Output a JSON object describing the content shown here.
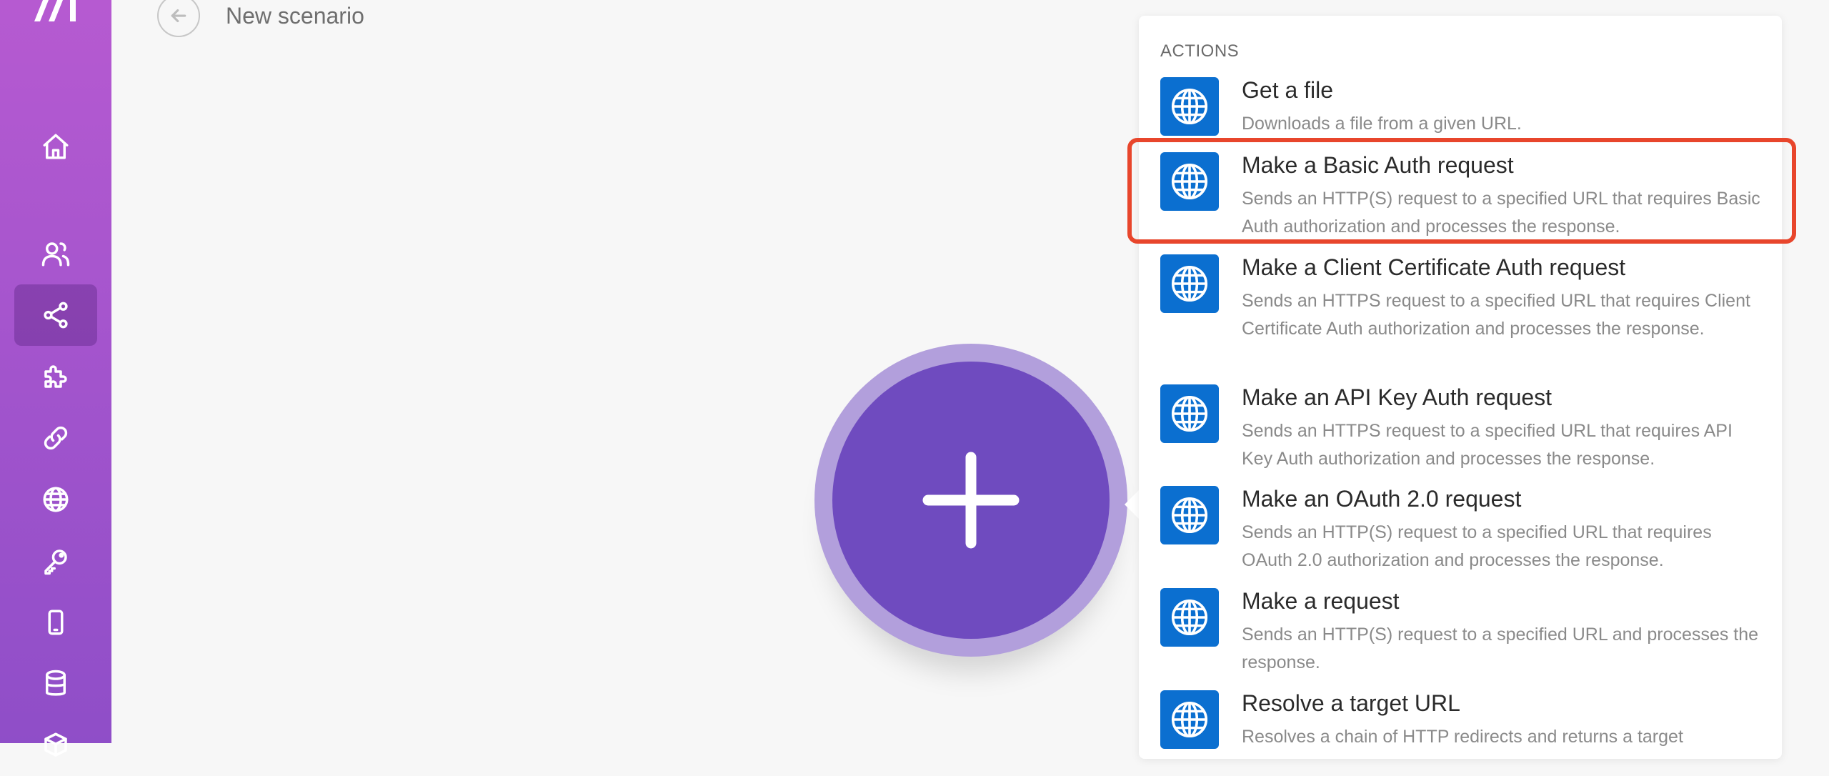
{
  "header": {
    "title": "New scenario"
  },
  "sidebar": {
    "items": [
      {
        "name": "home",
        "icon": "home-icon",
        "active": false
      },
      {
        "name": "team",
        "icon": "users-icon",
        "active": false
      },
      {
        "name": "scenarios",
        "icon": "share-icon",
        "active": true
      },
      {
        "name": "apps",
        "icon": "puzzle-icon",
        "active": false
      },
      {
        "name": "connections",
        "icon": "link-icon",
        "active": false
      },
      {
        "name": "webhooks",
        "icon": "globe-icon",
        "active": false
      },
      {
        "name": "keys",
        "icon": "key-icon",
        "active": false
      },
      {
        "name": "devices",
        "icon": "mobile-icon",
        "active": false
      },
      {
        "name": "data-stores",
        "icon": "database-icon",
        "active": false
      },
      {
        "name": "data-structures",
        "icon": "cube-icon",
        "active": false
      }
    ]
  },
  "panel": {
    "section_label": "ACTIONS",
    "highlighted_index": 1,
    "accent_color": "#e8462c",
    "icon_color": "#0b6fd0",
    "actions": [
      {
        "title": "Get a file",
        "description": "Downloads a file from a given URL."
      },
      {
        "title": "Make a Basic Auth request",
        "description": "Sends an HTTP(S) request to a specified URL that requires Basic Auth authorization and processes the response."
      },
      {
        "title": "Make a Client Certificate Auth request",
        "description": "Sends an HTTPS request to a specified URL that requires Client Certificate Auth authorization and processes the response."
      },
      {
        "title": "Make an API Key Auth request",
        "description": "Sends an HTTPS request to a specified URL that requires API Key Auth authorization and processes the response."
      },
      {
        "title": "Make an OAuth 2.0 request",
        "description": "Sends an HTTP(S) request to a specified URL that requires OAuth 2.0 authorization and processes the response."
      },
      {
        "title": "Make a request",
        "description": "Sends an HTTP(S) request to a specified URL and processes the response."
      },
      {
        "title": "Resolve a target URL",
        "description": "Resolves a chain of HTTP redirects and returns a target"
      }
    ]
  },
  "canvas": {
    "add_module_color": "#6f4bbf"
  }
}
